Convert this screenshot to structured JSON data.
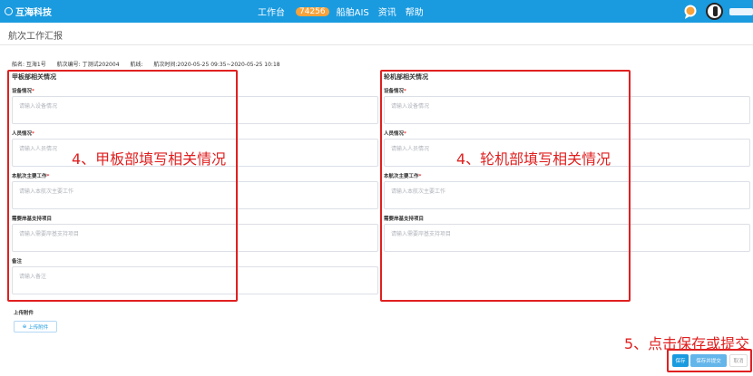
{
  "header": {
    "brand": "互海科技",
    "nav": {
      "workbench": "工作台",
      "workbench_badge": "74256",
      "ship_ais": "船舶AIS",
      "news": "资讯",
      "help": "帮助"
    },
    "icons": [
      "chat-icon",
      "avatar"
    ]
  },
  "page": {
    "title": "航次工作汇报"
  },
  "meta": {
    "ship": "船名: 互海1号",
    "voyage_no": "航次编号: 丁测试202004",
    "route": "航线:",
    "voyage_time": "航次时间:2020-05-25 09:35~2020-05-25 10:18"
  },
  "deck": {
    "title": "甲板部相关情况",
    "fields": [
      {
        "label": "设备情况",
        "required": true,
        "placeholder": "请输入设备情况"
      },
      {
        "label": "人员情况",
        "required": true,
        "placeholder": "请输入人员情况"
      },
      {
        "label": "本航次主要工作",
        "required": true,
        "placeholder": "请输入本航次主要工作"
      },
      {
        "label": "需要岸基支持项目",
        "required": false,
        "placeholder": "请输入需要岸基支持项目"
      },
      {
        "label": "备注",
        "required": false,
        "placeholder": "请输入备注"
      }
    ]
  },
  "engine": {
    "title": "轮机部相关情况",
    "fields": [
      {
        "label": "设备情况",
        "required": true,
        "placeholder": "请输入设备情况"
      },
      {
        "label": "人员情况",
        "required": true,
        "placeholder": "请输入人员情况"
      },
      {
        "label": "本航次主要工作",
        "required": true,
        "placeholder": "请输入本航次主要工作"
      },
      {
        "label": "需要岸基支持项目",
        "required": false,
        "placeholder": "请输入需要岸基支持项目"
      }
    ]
  },
  "upload": {
    "label": "上传附件",
    "button": "上传附件"
  },
  "actions": {
    "save": "保存",
    "save_submit": "保存并提交",
    "cancel": "取消"
  },
  "annotations": {
    "deck": "4、甲板部填写相关情况",
    "engine": "4、轮机部填写相关情况",
    "save": "5、点击保存或提交"
  },
  "colors": {
    "primary": "#1a9be0",
    "badge": "#f7a23b",
    "annotation": "#e02020"
  }
}
